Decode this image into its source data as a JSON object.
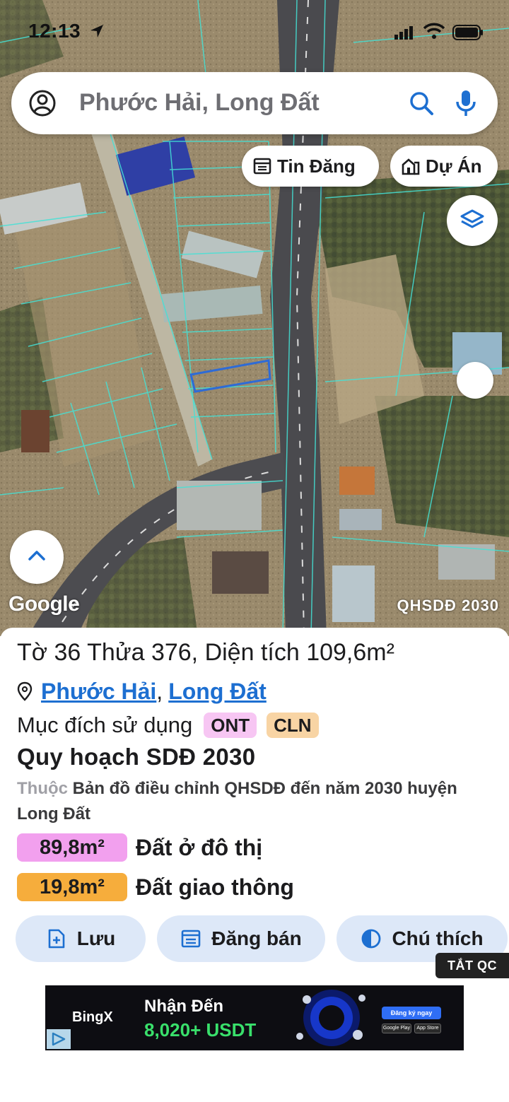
{
  "status_bar": {
    "time": "12:13"
  },
  "search": {
    "query": "Phước Hải, Long Đất"
  },
  "map": {
    "buttons": {
      "listings": "Tin Đăng",
      "projects": "Dự Án"
    },
    "google_logo": "Google",
    "layer_tag": "QHSDĐ 2030"
  },
  "parcel": {
    "title": "Tờ 36 Thửa 376, Diện tích 109,6m²",
    "ward": "Phước Hải",
    "comma": ",",
    "district": "Long Đất",
    "purpose_label": "Mục đích sử dụng",
    "purpose_codes": [
      "ONT",
      "CLN"
    ],
    "plan_title": "Quy hoạch SDĐ 2030",
    "plan_desc_prefix": "Thuộc",
    "plan_desc": "Bản đồ điều chỉnh QHSDĐ đến năm 2030 huyện Long Đất",
    "areas": [
      {
        "value": "89,8m²",
        "label": "Đất ở đô thị",
        "color": "#f2a0ee"
      },
      {
        "value": "19,8m²",
        "label": "Đất giao thông",
        "color": "#f6ad3c"
      }
    ]
  },
  "actions": {
    "save": "Lưu",
    "post": "Đăng bán",
    "legend": "Chú thích"
  },
  "ad": {
    "hide_label": "TẮT QC",
    "brand": "BingX",
    "line1": "Nhận Đến",
    "line2": "8,020+ USDT",
    "cta": "Đăng ký ngay",
    "store1": "Google Play",
    "store2": "App Store"
  },
  "colors": {
    "accent": "#1d6fd1",
    "button_bg": "#dde8f8",
    "ont": "#f7c6f3",
    "cln": "#f8d4a4"
  }
}
